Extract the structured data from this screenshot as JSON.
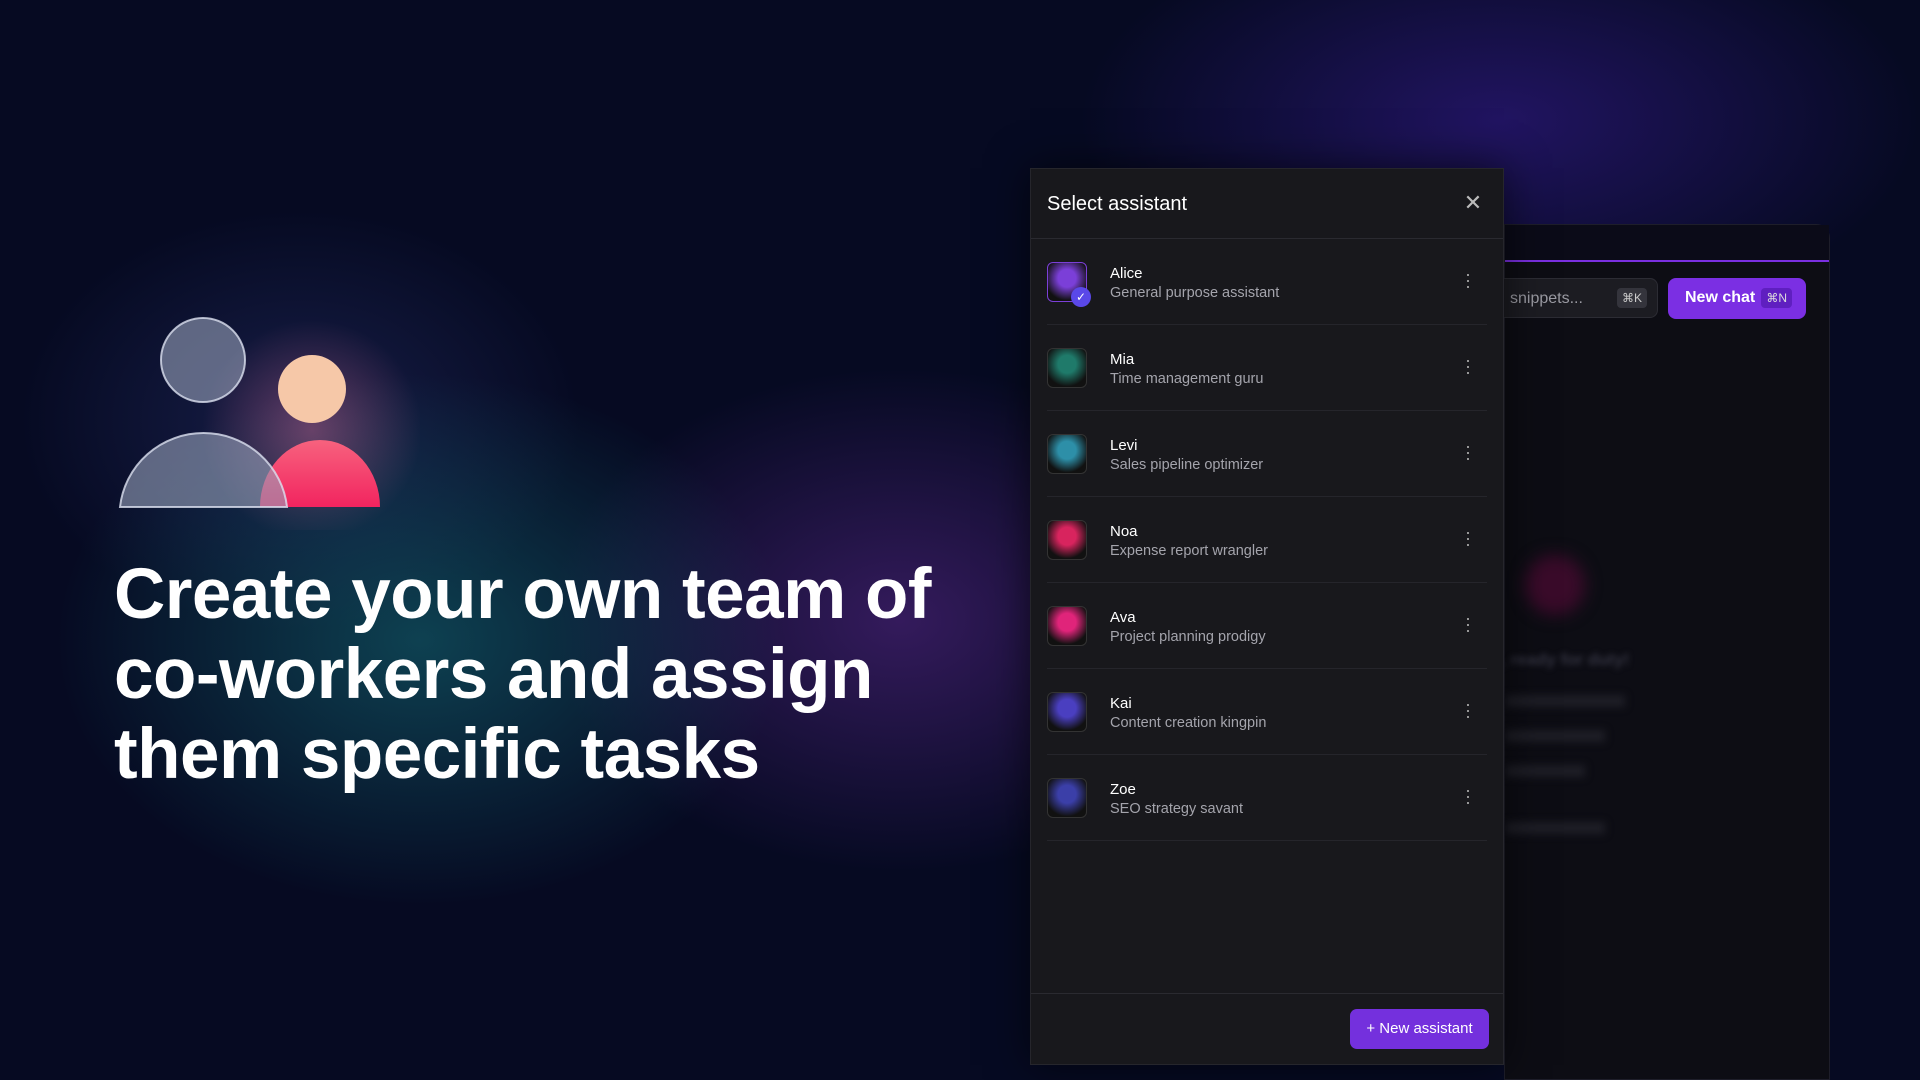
{
  "hero": {
    "headline": "Create your own team of co-workers and assign them specific tasks",
    "icon": "users-icon"
  },
  "background_window": {
    "search_placeholder": "snippets...",
    "search_shortcut": "⌘K",
    "new_chat_label": "New chat",
    "new_chat_shortcut": "⌘N",
    "greeting": ", ready for duty!"
  },
  "dialog": {
    "title": "Select assistant",
    "close_icon": "close-icon",
    "assistants": [
      {
        "name": "Alice",
        "description": "General purpose assistant",
        "selected": true,
        "color": "#7b3fd8"
      },
      {
        "name": "Mia",
        "description": "Time management guru",
        "selected": false,
        "color": "#1f7a6a"
      },
      {
        "name": "Levi",
        "description": "Sales pipeline optimizer",
        "selected": false,
        "color": "#2d8fa8"
      },
      {
        "name": "Noa",
        "description": "Expense report wrangler",
        "selected": false,
        "color": "#d8245e"
      },
      {
        "name": "Ava",
        "description": "Project planning prodigy",
        "selected": false,
        "color": "#e0247a"
      },
      {
        "name": "Kai",
        "description": "Content creation kingpin",
        "selected": false,
        "color": "#4a3fc0"
      },
      {
        "name": "Zoe",
        "description": "SEO strategy savant",
        "selected": false,
        "color": "#3b3fa8"
      }
    ],
    "new_assistant_label": "+ New assistant"
  },
  "colors": {
    "accent": "#7430dd",
    "panel": "#18181c"
  }
}
